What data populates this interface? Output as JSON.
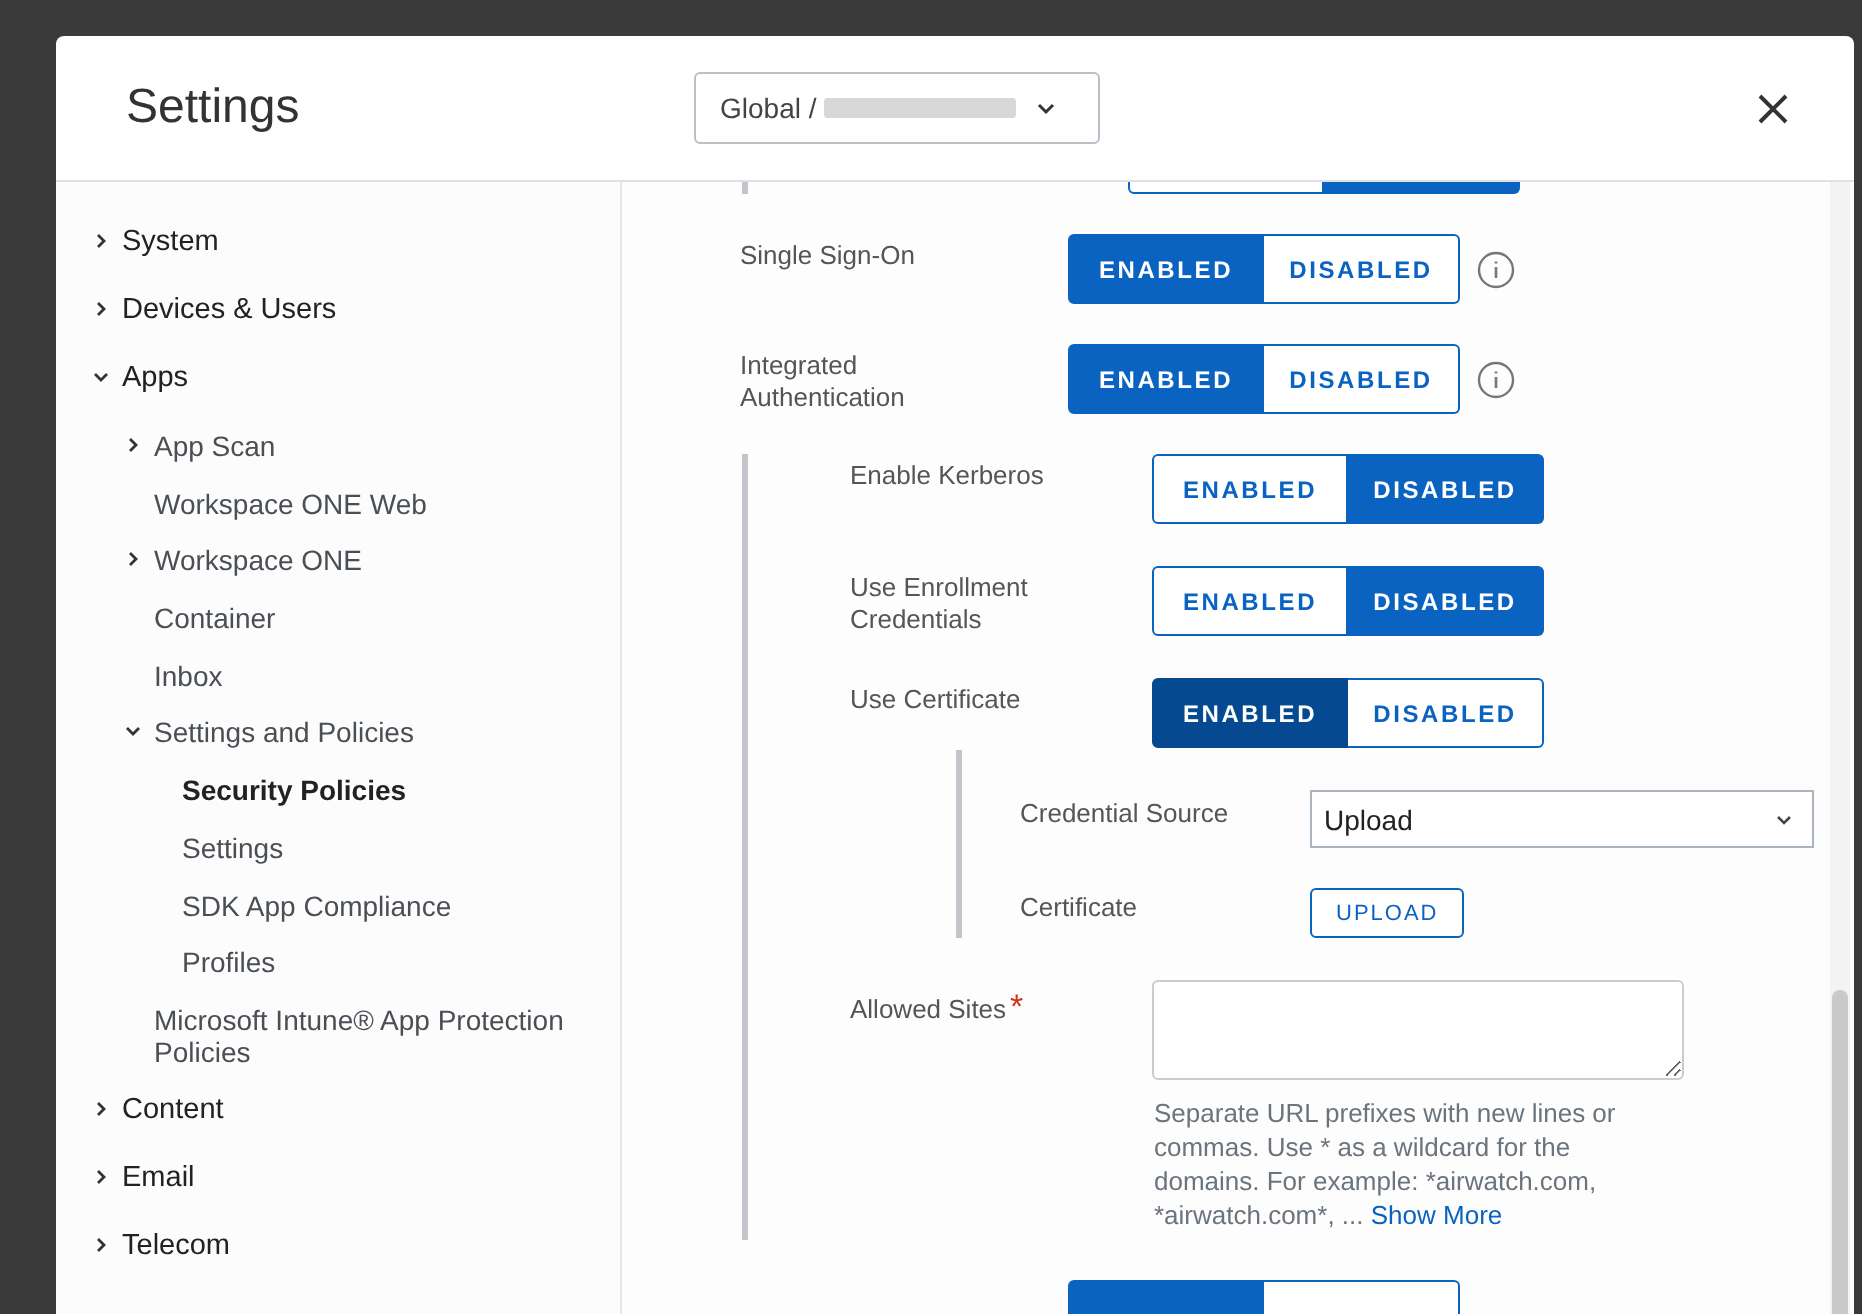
{
  "window": {
    "title": "Settings"
  },
  "scope_selector": {
    "value": "Global / "
  },
  "clipped_toggle_above": {
    "options": [
      {
        "selected": false
      },
      {
        "selected": true
      }
    ]
  },
  "clipped_toggle_below": {
    "options": [
      {
        "selected": true
      },
      {
        "selected": false
      }
    ]
  },
  "sidebar": {
    "items": [
      {
        "label": "System",
        "expanded": false,
        "selected": false
      },
      {
        "label": "Devices & Users",
        "expanded": false,
        "selected": false
      },
      {
        "label": "Apps",
        "expanded": true,
        "selected": false,
        "children": [
          {
            "label": "App Scan",
            "expanded": false,
            "selected": false
          },
          {
            "label": "Workspace ONE Web",
            "selected": false
          },
          {
            "label": "Workspace ONE",
            "expanded": false,
            "selected": false
          },
          {
            "label": "Container",
            "selected": false
          },
          {
            "label": "Inbox",
            "selected": false
          },
          {
            "label": "Settings and Policies",
            "expanded": true,
            "selected": false,
            "children": [
              {
                "label": "Security Policies",
                "selected": true
              },
              {
                "label": "Settings",
                "selected": false
              },
              {
                "label": "SDK App Compliance",
                "selected": false
              },
              {
                "label": "Profiles",
                "selected": false
              }
            ]
          },
          {
            "label": "Microsoft Intune® App Protection Policies",
            "selected": false
          }
        ]
      },
      {
        "label": "Content",
        "expanded": false,
        "selected": false
      },
      {
        "label": "Email",
        "expanded": false,
        "selected": false
      },
      {
        "label": "Telecom",
        "expanded": false,
        "selected": false
      }
    ]
  },
  "settings": [
    {
      "kind": "toggle",
      "label": "Single Sign-On",
      "info": true,
      "options": [
        {
          "label": "ENABLED",
          "selected": true
        },
        {
          "label": "DISABLED",
          "selected": false
        }
      ]
    },
    {
      "kind": "toggle",
      "label": "Integrated Authentication",
      "info": true,
      "options": [
        {
          "label": "ENABLED",
          "selected": true
        },
        {
          "label": "DISABLED",
          "selected": false
        }
      ],
      "children": [
        {
          "kind": "toggle",
          "label": "Enable Kerberos",
          "options": [
            {
              "label": "ENABLED",
              "selected": false
            },
            {
              "label": "DISABLED",
              "selected": true
            }
          ]
        },
        {
          "kind": "toggle",
          "label": "Use Enrollment Credentials",
          "options": [
            {
              "label": "ENABLED",
              "selected": false
            },
            {
              "label": "DISABLED",
              "selected": true
            }
          ]
        },
        {
          "kind": "toggle",
          "label": "Use Certificate",
          "focused": true,
          "options": [
            {
              "label": "ENABLED",
              "selected": true
            },
            {
              "label": "DISABLED",
              "selected": false
            }
          ],
          "children": [
            {
              "kind": "select",
              "label": "Credential Source",
              "value": "Upload"
            },
            {
              "kind": "upload",
              "label": "Certificate",
              "button": "UPLOAD"
            }
          ]
        },
        {
          "kind": "textarea",
          "label": "Allowed Sites",
          "required_mark": "*",
          "help": "Separate URL prefixes with new lines or commas. Use * as a wildcard for the domains. For example: *airwatch.com, *airwatch.com*, ...",
          "link": "Show More"
        }
      ]
    }
  ]
}
